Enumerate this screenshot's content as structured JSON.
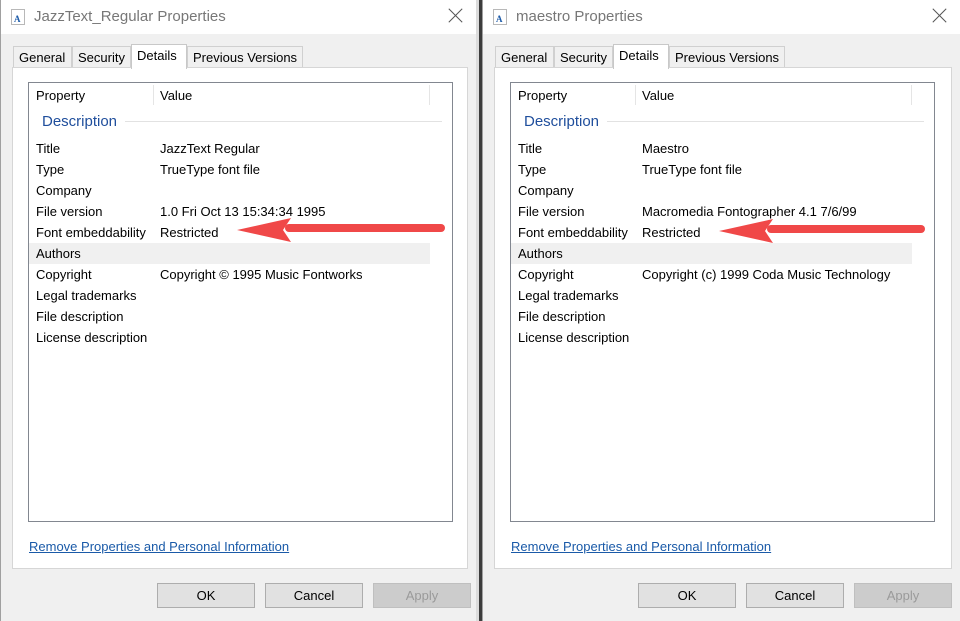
{
  "windows": [
    {
      "title": "JazzText_Regular Properties",
      "icon": "font-file-icon",
      "tabs": [
        {
          "label": "General",
          "active": false
        },
        {
          "label": "Security",
          "active": false
        },
        {
          "label": "Details",
          "active": true
        },
        {
          "label": "Previous Versions",
          "active": false
        }
      ],
      "columns": {
        "property": "Property",
        "value": "Value"
      },
      "group": "Description",
      "rows": [
        {
          "key": "Title",
          "value": "JazzText Regular"
        },
        {
          "key": "Type",
          "value": "TrueType font file"
        },
        {
          "key": "Company",
          "value": ""
        },
        {
          "key": "File version",
          "value": "1.0 Fri Oct 13 15:34:34 1995"
        },
        {
          "key": "Font embeddability",
          "value": "Restricted"
        },
        {
          "key": "Authors",
          "value": ""
        },
        {
          "key": "Copyright",
          "value": "Copyright © 1995 Music Fontworks"
        },
        {
          "key": "Legal trademarks",
          "value": ""
        },
        {
          "key": "File description",
          "value": ""
        },
        {
          "key": "License description",
          "value": ""
        }
      ],
      "link": "Remove Properties and Personal Information",
      "buttons": {
        "ok": "OK",
        "cancel": "Cancel",
        "apply": "Apply"
      }
    },
    {
      "title": "maestro Properties",
      "icon": "font-file-icon",
      "tabs": [
        {
          "label": "General",
          "active": false
        },
        {
          "label": "Security",
          "active": false
        },
        {
          "label": "Details",
          "active": true
        },
        {
          "label": "Previous Versions",
          "active": false
        }
      ],
      "columns": {
        "property": "Property",
        "value": "Value"
      },
      "group": "Description",
      "rows": [
        {
          "key": "Title",
          "value": "Maestro"
        },
        {
          "key": "Type",
          "value": "TrueType font file"
        },
        {
          "key": "Company",
          "value": ""
        },
        {
          "key": "File version",
          "value": "Macromedia Fontographer 4.1 7/6/99"
        },
        {
          "key": "Font embeddability",
          "value": "Restricted"
        },
        {
          "key": "Authors",
          "value": ""
        },
        {
          "key": "Copyright",
          "value": "Copyright (c) 1999 Coda Music Technology"
        },
        {
          "key": "Legal trademarks",
          "value": ""
        },
        {
          "key": "File description",
          "value": ""
        },
        {
          "key": "License description",
          "value": ""
        }
      ],
      "link": "Remove Properties and Personal Information",
      "buttons": {
        "ok": "OK",
        "cancel": "Cancel",
        "apply": "Apply"
      }
    }
  ],
  "annotation_color": "#f04848"
}
